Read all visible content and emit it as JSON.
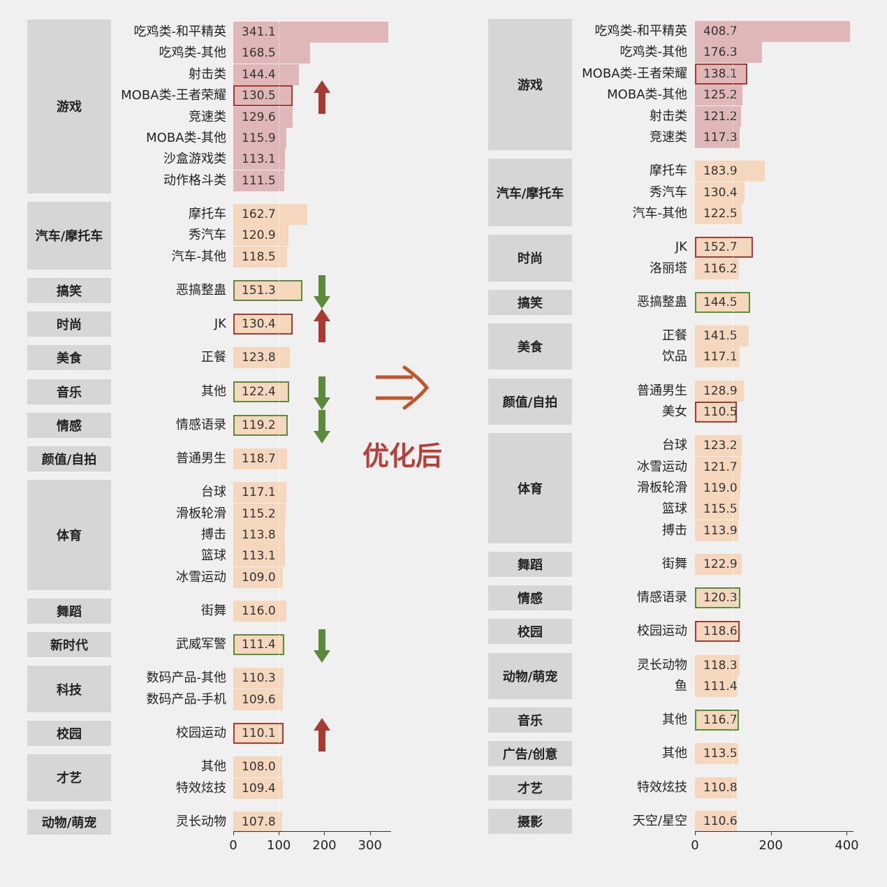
{
  "after_label": "优化后",
  "colors": {
    "category_bg": "#d6d6d6",
    "games_bar": "#e0b7b8",
    "other_bar": "#f4d7bd",
    "red_outline": "#a83a32",
    "green_outline": "#5a8a3a",
    "up_arrow": "#a83a32",
    "down_arrow": "#5b8a3a",
    "transition_arrow": "#c0572a"
  },
  "chart_data": [
    {
      "type": "bar",
      "orientation": "horizontal",
      "xlim": [
        0,
        340
      ],
      "xticks": [
        "0",
        "100",
        "200",
        "300"
      ],
      "xtick_values": [
        0,
        100,
        200,
        300
      ],
      "groups": [
        {
          "category": "游戏",
          "items": [
            {
              "label": "吃鸡类-和平精英",
              "value": "341.1"
            },
            {
              "label": "吃鸡类-其他",
              "value": "168.5"
            },
            {
              "label": "射击类",
              "value": "144.4"
            },
            {
              "label": "MOBA类-王者荣耀",
              "value": "130.5",
              "highlight": "red",
              "arrow": "up"
            },
            {
              "label": "竞速类",
              "value": "129.6"
            },
            {
              "label": "MOBA类-其他",
              "value": "115.9"
            },
            {
              "label": "沙盒游戏类",
              "value": "113.1"
            },
            {
              "label": "动作格斗类",
              "value": "111.5"
            }
          ]
        },
        {
          "category": "汽车/摩托车",
          "items": [
            {
              "label": "摩托车",
              "value": "162.7"
            },
            {
              "label": "秀汽车",
              "value": "120.9"
            },
            {
              "label": "汽车-其他",
              "value": "118.5"
            }
          ]
        },
        {
          "category": "搞笑",
          "items": [
            {
              "label": "恶搞整蛊",
              "value": "151.3",
              "highlight": "green",
              "arrow": "down"
            }
          ]
        },
        {
          "category": "时尚",
          "items": [
            {
              "label": "JK",
              "value": "130.4",
              "highlight": "red",
              "arrow": "up"
            }
          ]
        },
        {
          "category": "美食",
          "items": [
            {
              "label": "正餐",
              "value": "123.8"
            }
          ]
        },
        {
          "category": "音乐",
          "items": [
            {
              "label": "其他",
              "value": "122.4",
              "highlight": "green",
              "arrow": "down"
            }
          ]
        },
        {
          "category": "情感",
          "items": [
            {
              "label": "情感语录",
              "value": "119.2",
              "highlight": "green",
              "arrow": "down"
            }
          ]
        },
        {
          "category": "颜值/自拍",
          "items": [
            {
              "label": "普通男生",
              "value": "118.7"
            }
          ]
        },
        {
          "category": "体育",
          "items": [
            {
              "label": "台球",
              "value": "117.1"
            },
            {
              "label": "滑板轮滑",
              "value": "115.2"
            },
            {
              "label": "搏击",
              "value": "113.8"
            },
            {
              "label": "篮球",
              "value": "113.1"
            },
            {
              "label": "冰雪运动",
              "value": "109.0"
            }
          ]
        },
        {
          "category": "舞蹈",
          "items": [
            {
              "label": "街舞",
              "value": "116.0"
            }
          ]
        },
        {
          "category": "新时代",
          "items": [
            {
              "label": "武威军警",
              "value": "111.4",
              "highlight": "green",
              "arrow": "down"
            }
          ]
        },
        {
          "category": "科技",
          "items": [
            {
              "label": "数码产品-其他",
              "value": "110.3"
            },
            {
              "label": "数码产品-手机",
              "value": "109.6"
            }
          ]
        },
        {
          "category": "校园",
          "items": [
            {
              "label": "校园运动",
              "value": "110.1",
              "highlight": "red",
              "arrow": "up"
            }
          ]
        },
        {
          "category": "才艺",
          "items": [
            {
              "label": "其他",
              "value": "108.0"
            },
            {
              "label": "特效炫技",
              "value": "109.4"
            }
          ]
        },
        {
          "category": "动物/萌宠",
          "items": [
            {
              "label": "灵长动物",
              "value": "107.8"
            }
          ]
        }
      ]
    },
    {
      "type": "bar",
      "orientation": "horizontal",
      "xlim": [
        0,
        410
      ],
      "xticks": [
        "0",
        "200",
        "400"
      ],
      "xtick_values": [
        0,
        200,
        400
      ],
      "groups": [
        {
          "category": "游戏",
          "items": [
            {
              "label": "吃鸡类-和平精英",
              "value": "408.7"
            },
            {
              "label": "吃鸡类-其他",
              "value": "176.3"
            },
            {
              "label": "MOBA类-王者荣耀",
              "value": "138.1",
              "highlight": "red"
            },
            {
              "label": "MOBA类-其他",
              "value": "125.2"
            },
            {
              "label": "射击类",
              "value": "121.2"
            },
            {
              "label": "竞速类",
              "value": "117.3"
            }
          ]
        },
        {
          "category": "汽车/摩托车",
          "items": [
            {
              "label": "摩托车",
              "value": "183.9"
            },
            {
              "label": "秀汽车",
              "value": "130.4"
            },
            {
              "label": "汽车-其他",
              "value": "122.5"
            }
          ]
        },
        {
          "category": "时尚",
          "items": [
            {
              "label": "JK",
              "value": "152.7",
              "highlight": "red"
            },
            {
              "label": "洛丽塔",
              "value": "116.2"
            }
          ]
        },
        {
          "category": "搞笑",
          "items": [
            {
              "label": "恶搞整蛊",
              "value": "144.5",
              "highlight": "green"
            }
          ]
        },
        {
          "category": "美食",
          "items": [
            {
              "label": "正餐",
              "value": "141.5"
            },
            {
              "label": "饮品",
              "value": "117.1"
            }
          ]
        },
        {
          "category": "颜值/自拍",
          "items": [
            {
              "label": "普通男生",
              "value": "128.9"
            },
            {
              "label": "美女",
              "value": "110.5",
              "highlight": "red"
            }
          ]
        },
        {
          "category": "体育",
          "items": [
            {
              "label": "台球",
              "value": "123.2"
            },
            {
              "label": "冰雪运动",
              "value": "121.7"
            },
            {
              "label": "滑板轮滑",
              "value": "119.0"
            },
            {
              "label": "篮球",
              "value": "115.5"
            },
            {
              "label": "搏击",
              "value": "113.9"
            }
          ]
        },
        {
          "category": "舞蹈",
          "items": [
            {
              "label": "街舞",
              "value": "122.9"
            }
          ]
        },
        {
          "category": "情感",
          "items": [
            {
              "label": "情感语录",
              "value": "120.3",
              "highlight": "green"
            }
          ]
        },
        {
          "category": "校园",
          "items": [
            {
              "label": "校园运动",
              "value": "118.6",
              "highlight": "red"
            }
          ]
        },
        {
          "category": "动物/萌宠",
          "items": [
            {
              "label": "灵长动物",
              "value": "118.3"
            },
            {
              "label": "鱼",
              "value": "111.4"
            }
          ]
        },
        {
          "category": "音乐",
          "items": [
            {
              "label": "其他",
              "value": "116.7",
              "highlight": "green"
            }
          ]
        },
        {
          "category": "广告/创意",
          "items": [
            {
              "label": "其他",
              "value": "113.5"
            }
          ]
        },
        {
          "category": "才艺",
          "items": [
            {
              "label": "特效炫技",
              "value": "110.8"
            }
          ]
        },
        {
          "category": "摄影",
          "items": [
            {
              "label": "天空/星空",
              "value": "110.6"
            }
          ]
        }
      ]
    }
  ]
}
